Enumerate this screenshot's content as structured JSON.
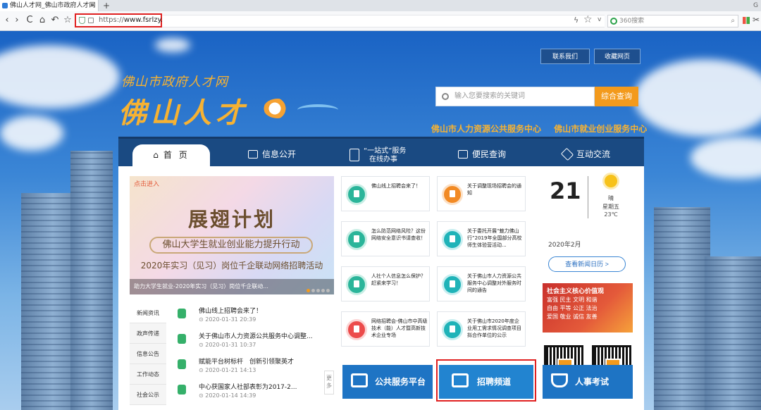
{
  "browser": {
    "tab_title": "佛山人才网_佛山市政府人才网",
    "tab_close": "×",
    "new_tab": "+",
    "tabbar_right": "G",
    "url_prefix": "https://",
    "url_domain": "www.fsrlzy.cn",
    "search_placeholder": "360搜索",
    "nav_back": "‹",
    "nav_forward": "›",
    "nav_reload": "C",
    "nav_home": "⌂",
    "nav_undo": "↶",
    "nav_bookmark": "☆",
    "nav_bolt": "ϟ",
    "nav_star": "☆",
    "nav_drop": "v",
    "search_icon": "⌕",
    "nav_more": "✂"
  },
  "header": {
    "contact": "联系我们",
    "favorite": "收藏网页",
    "subtitle": "佛山市政府人才网",
    "title": "佛山人才",
    "search_placeholder": "输入您要搜索的关键词",
    "search_button": "综合查询",
    "center_1": "佛山市人力资源公共服务中心",
    "center_2": "佛山市就业创业服务中心"
  },
  "nav": {
    "home": "首 页",
    "info": "信息公开",
    "onestop_line1": "“一站式”服务",
    "onestop_line2": "在线办事",
    "query": "便民查询",
    "interact": "互动交流"
  },
  "banner": {
    "tag": "点击进入",
    "title": "展翅计划",
    "subtitle": "佛山大学生就业创业能力提升行动",
    "line": "2020年实习（见习）岗位千企联动网络招聘活动",
    "caption": "助力大学生就业-2020年实习（见习）岗位千企联动..."
  },
  "news": {
    "tabs": [
      "新闻资讯",
      "政声传递",
      "信息公告",
      "工作动态",
      "社会公示"
    ],
    "items": [
      {
        "title": "佛山线上招聘会来了！",
        "date": "2020-01-31 20:39"
      },
      {
        "title": "关于佛山市人力资源公共服务中心调整...",
        "date": "2020-01-31 10:37"
      },
      {
        "title": "赋能平台树标杆　创新引领聚英才",
        "date": "2020-01-21 14:13"
      },
      {
        "title": "中心获国家人社部表彰为2017-2...",
        "date": "2020-01-14 14:39"
      }
    ],
    "more": "更多"
  },
  "cards": [
    {
      "text": "佛山线上招聘会来了！"
    },
    {
      "text": "关于调整现场招聘会的通知"
    },
    {
      "text": "怎么防范网络风险？这份网络安全意识书请查收！"
    },
    {
      "text": "关于委托开展“魅力佛山行”2019年全国部分高校师生体验营活动..."
    },
    {
      "text": "人社个人信息怎么保护？赶紧来学习！"
    },
    {
      "text": "关于佛山市人力资源公共服务中心调整对外服务时间的通告"
    },
    {
      "text": "网络招聘会-佛山市中高级技术（能）人才暨高新技术企业专场"
    },
    {
      "text": "关于佛山市2020年度企业用工需求情况调查项目拟合作单位的公示"
    }
  ],
  "tiles": {
    "public": "公共服务平台",
    "recruit": "招聘频道",
    "exam": "人事考试"
  },
  "calendar": {
    "day": "21",
    "month": "2020年2月",
    "weather": "晴",
    "weekday": "星期五",
    "temp": "23℃",
    "button": "查看新闻日历 >"
  },
  "poster": {
    "line1": "社会主义核心价值观",
    "line2": "富强 民主 文明 和谐",
    "line3": "自由 平等 公正 法治",
    "line4": "爱国 敬业 诚信 友善"
  }
}
